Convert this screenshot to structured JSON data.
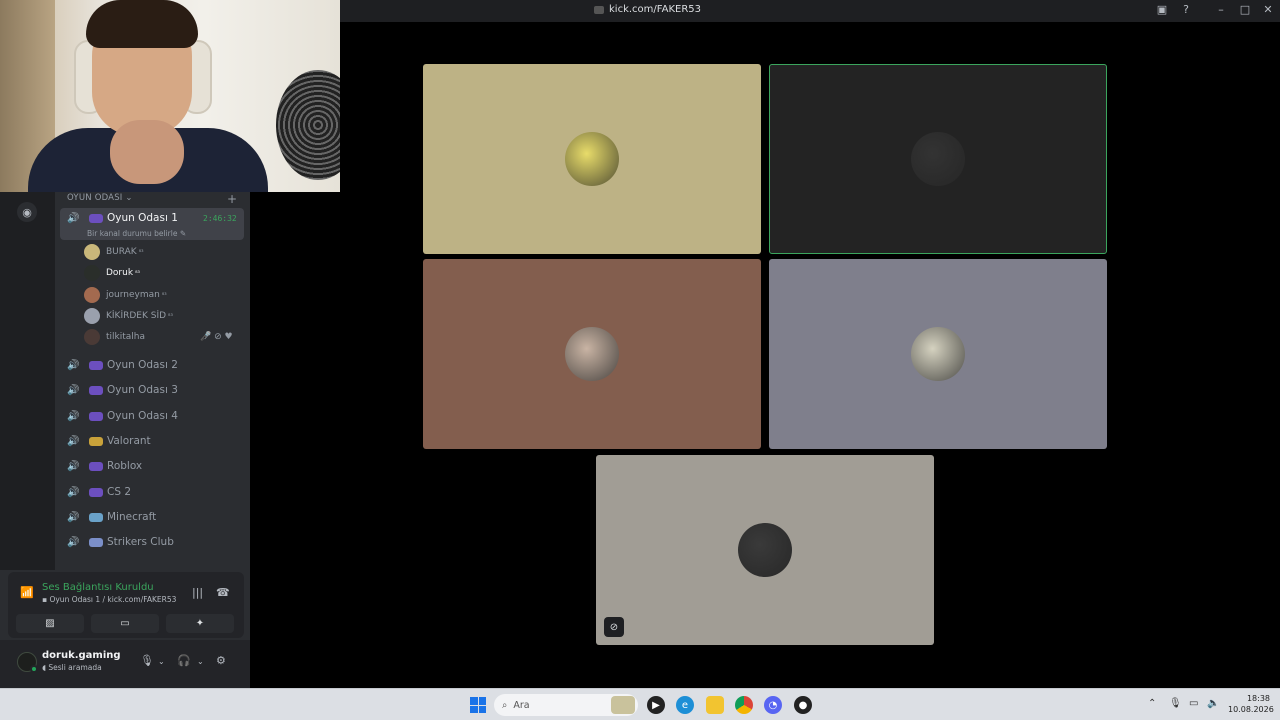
{
  "window": {
    "url": "kick.com/FAKER53"
  },
  "sidebar": {
    "category": "OYUN ODASI",
    "active_channel": {
      "name": "Oyun Odası 1",
      "timer": "2:46:32",
      "status": "Bir kanal durumu belirle"
    },
    "members": [
      {
        "name": "BURAK",
        "badge": "⁸³",
        "bold": false,
        "color": "#c9b77a"
      },
      {
        "name": "Doruk",
        "badge": "⁸³",
        "bold": true,
        "color": "#2a2e2a"
      },
      {
        "name": "journeyman",
        "badge": "⁸³",
        "bold": false,
        "color": "#a36a4f"
      },
      {
        "name": "KİKİRDEK SİD",
        "badge": "⁸³",
        "bold": false,
        "color": "#9aa0ad"
      },
      {
        "name": "tilkitalha",
        "badge": "",
        "bold": false,
        "color": "#4a3a36"
      }
    ],
    "channels": [
      {
        "name": "Oyun Odası 2",
        "icon_color": "#6c4fbf"
      },
      {
        "name": "Oyun Odası 3",
        "icon_color": "#6c4fbf"
      },
      {
        "name": "Oyun Odası 4",
        "icon_color": "#6c4fbf"
      },
      {
        "name": "Valorant",
        "icon_color": "#c9a23a"
      },
      {
        "name": "Roblox",
        "icon_color": "#6c4fbf"
      },
      {
        "name": "CS 2",
        "icon_color": "#6c4fbf"
      },
      {
        "name": "Minecraft",
        "icon_color": "#6aa2c9"
      },
      {
        "name": "Strikers Club",
        "icon_color": "#7b8fc9"
      }
    ]
  },
  "voice": {
    "title": "Ses Bağlantısı Kuruldu",
    "subtitle": "Oyun Odası 1 / kick.com/FAKER53"
  },
  "user": {
    "name": "doruk.gaming",
    "status": "Sesli aramada"
  },
  "stage": {
    "tiles": [
      {
        "bg": "#bdb285",
        "avatar": "#e8dc6a",
        "speaking": false
      },
      {
        "bg": "#232323",
        "avatar": "#333333",
        "speaking": true
      },
      {
        "bg": "#835e4e",
        "avatar": "#c9b4a4",
        "speaking": false
      },
      {
        "bg": "#7f7f8c",
        "avatar": "#d5d2c0",
        "speaking": false
      },
      {
        "bg": "#a19d95",
        "avatar": "#3a3a3a",
        "speaking": false
      }
    ]
  },
  "taskbar": {
    "search_placeholder": "Ara",
    "time": "18:38",
    "date": "10.08.2026"
  }
}
